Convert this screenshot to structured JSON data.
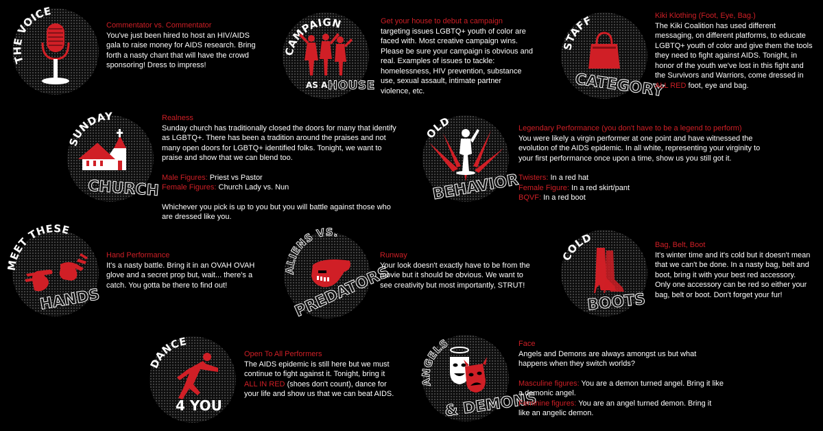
{
  "colors": {
    "accent_red": "#d01f26",
    "background": "#000000",
    "text": "#ffffff"
  },
  "categories": [
    {
      "id": "the-voice",
      "badge": {
        "line1": "THE VOICE",
        "icon": "microphone-icon"
      },
      "heading": "Commentator vs. Commentator",
      "body": "You've just been hired to host an HIV/AIDS gala to raise money for AIDS research. Bring forth a nasty chant that will have the crowd sponsoring! Dress to impress!"
    },
    {
      "id": "campaign-as-a-house",
      "badge": {
        "line1": "CAMPAIGN",
        "line2a": "AS A",
        "line2b": "HOUSE",
        "icon": "dancers-icon"
      },
      "heading": "Get your house to debut a campaign",
      "body": "targeting issues LGBTQ+ youth of color are faced with. Most creative campaign wins. Please be sure your campaign is obvious and real. Examples of issues to tackle: homelessness, HIV prevention, substance use, sexual assault, intimate partner violence, etc."
    },
    {
      "id": "staff-category",
      "badge": {
        "line1": "STAFF",
        "line2": "CATEGORY",
        "icon": "handbag-icon"
      },
      "heading": "Kiki Klothing (Foot, Eye, Bag.)",
      "body_pre": "The Kiki Coalition has used different messaging, on different platforms, to educate LGBTQ+ youth of color and give them the tools they need to fight against AIDS. Tonight, in honor of the youth we've lost in this fight and the Survivors and Warriors, come dressed in ",
      "body_red": "ALL RED",
      "body_post": " foot, eye and bag."
    },
    {
      "id": "sunday-church",
      "badge": {
        "line1": "SUNDAY",
        "line2": "CHURCH",
        "icon": "church-icon"
      },
      "heading": "Realness",
      "body": "Sunday church has traditionally closed the doors for many that identify as LGBTQ+. There has been a tradition around the praises and not many open doors for LGBTQ+ identified folks. Tonight, we want to praise and show that we can blend too.",
      "details": [
        {
          "label": "Male Figures:",
          "value": " Priest vs Pastor"
        },
        {
          "label": "Female Figures:",
          "value": " Church Lady vs. Nun"
        }
      ],
      "footer": "Whichever you pick is up to you but you will battle against those who are dressed like you."
    },
    {
      "id": "old-behavior",
      "badge": {
        "line1": "OLD",
        "line2": "BEHAVIOR",
        "icon": "performer-silhouette-icon"
      },
      "heading": "Legendary Performance (you don't have to be a legend to perform)",
      "body": "You were likely a virgin performer at one point and have witnessed the evolution of the AIDS epidemic. In all white, representing your virginity to your first performance once upon a time, show us you still got it.",
      "details": [
        {
          "label": "Twisters:",
          "value": " In a red hat"
        },
        {
          "label": "Female Figure:",
          "value": " In a red skirt/pant"
        },
        {
          "label": "BQVF:",
          "value": " In a red boot"
        }
      ]
    },
    {
      "id": "meet-these-hands",
      "badge": {
        "line1": "MEET THESE",
        "line2": "HANDS",
        "icon": "hands-icon"
      },
      "heading": "Hand Performance",
      "body": "It's a nasty battle. Bring it in an OVAH OVAH glove and a secret prop but, wait... there's a catch. You gotta be there to find out!"
    },
    {
      "id": "aliens-vs-predators",
      "badge": {
        "line1": "ALIENS VS.",
        "line2": "PREDATORS",
        "icon": "alien-head-icon"
      },
      "heading": "Runway",
      "body": "Your look doesn't exactly have to be from the movie but it should be obvious. We want to see creativity but most importantly, STRUT!"
    },
    {
      "id": "cold-boots",
      "badge": {
        "line1": "COLD",
        "line2": "BOOTS",
        "icon": "boots-icon"
      },
      "heading": "Bag, Belt, Boot",
      "body": "It's winter time and it's cold but it doesn't mean that we can't be done. In a nasty bag, belt and boot, bring it with your best red accessory. Only one accessory can be red so either your bag, belt or boot. Don't forget your fur!"
    },
    {
      "id": "dance-4-you",
      "badge": {
        "line1": "DANCE",
        "line2": "4 YOU",
        "icon": "dancer-icon"
      },
      "heading": "Open To All Performers",
      "body_pre": "The AIDS epidemic is still here but we must continue to fight against it. Tonight, bring it ",
      "body_red": "ALL IN RED",
      "body_post": " (shoes don't count), dance for your life and show us that we can beat AIDS."
    },
    {
      "id": "angels-and-demons",
      "badge": {
        "line1": "ANGELS",
        "line2": "& DEMONS",
        "icon": "theater-masks-icon"
      },
      "heading": "Face",
      "body": "Angels and Demons are always amongst us but what happens when they switch worlds?",
      "details": [
        {
          "label": "Masculine figures:",
          "value": " You are a demon turned angel. Bring it like a demonic angel."
        },
        {
          "label": "Feminine figures:",
          "value": " You are an angel turned demon. Bring it like an angelic demon."
        }
      ]
    }
  ]
}
